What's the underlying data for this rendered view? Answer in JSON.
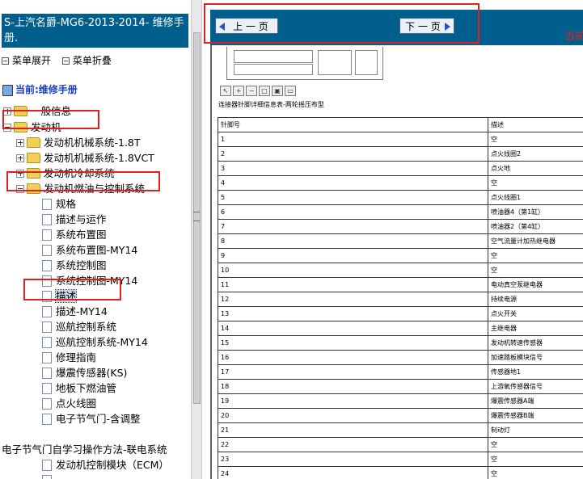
{
  "left": {
    "title": "S-上汽名爵-MG6-2013-2014- 维修手册.",
    "menu": {
      "expand_label": "菜单展开",
      "collapse_label": "菜单折叠"
    },
    "current_label": "当前:维修手册",
    "tree": [
      {
        "label": "一般信息",
        "type": "folder",
        "toggle": "plus"
      },
      {
        "label": "发动机",
        "type": "folder",
        "toggle": "minus"
      },
      {
        "label": "发动机机械系统-1.8T",
        "type": "folder",
        "toggle": "plus"
      },
      {
        "label": "发动机机械系统-1.8VCT",
        "type": "folder",
        "toggle": "plus"
      },
      {
        "label": "发动机冷却系统",
        "type": "folder",
        "toggle": "plus"
      },
      {
        "label": "发动机燃油与控制系统",
        "type": "folder",
        "toggle": "minus"
      },
      {
        "label": "规格",
        "type": "doc"
      },
      {
        "label": "描述与运作",
        "type": "doc"
      },
      {
        "label": "系统布置图",
        "type": "doc"
      },
      {
        "label": "系统布置图-MY14",
        "type": "doc"
      },
      {
        "label": "系统控制图",
        "type": "doc"
      },
      {
        "label": "系统控制图-MY14",
        "type": "doc"
      },
      {
        "label": "描述",
        "type": "doc",
        "selected": true
      },
      {
        "label": "描述-MY14",
        "type": "doc"
      },
      {
        "label": "巡航控制系统",
        "type": "doc"
      },
      {
        "label": "巡航控制系统-MY14",
        "type": "doc"
      },
      {
        "label": "修理指南",
        "type": "doc"
      },
      {
        "label": "爆震传感器(KS)",
        "type": "doc"
      },
      {
        "label": "地板下燃油管",
        "type": "doc"
      },
      {
        "label": "点火线圈",
        "type": "doc"
      },
      {
        "label": "电子节气门-含调整",
        "type": "doc"
      },
      {
        "label": "电子节气门自学习操作方法-联电系统",
        "type": "doc"
      },
      {
        "label": "发动机控制模块（ECM）",
        "type": "doc"
      },
      {
        "label": "",
        "type": "doc"
      }
    ]
  },
  "right": {
    "prev_label": "上 一 页",
    "next_label": "下 一 页",
    "current_label": "当前",
    "caption": "连接器针脚详细信息表-两轮摇压布型",
    "table": {
      "headers": [
        "针脚号",
        "描述"
      ],
      "rows": [
        [
          "1",
          "空"
        ],
        [
          "2",
          "点火线圈2"
        ],
        [
          "3",
          "点火地"
        ],
        [
          "4",
          "空"
        ],
        [
          "5",
          "点火线圈1"
        ],
        [
          "6",
          "喷油器4（第1缸）"
        ],
        [
          "7",
          "喷油器2（第4缸）"
        ],
        [
          "8",
          "空气流量计加热继电器"
        ],
        [
          "9",
          "空"
        ],
        [
          "10",
          "空"
        ],
        [
          "11",
          "电动真空泵继电器"
        ],
        [
          "12",
          "持续电源"
        ],
        [
          "13",
          "点火开关"
        ],
        [
          "14",
          "主继电器"
        ],
        [
          "15",
          "发动机转速传感器"
        ],
        [
          "16",
          "加速踏板模块信号"
        ],
        [
          "17",
          "传感器地1"
        ],
        [
          "18",
          "上游氧传感器信号"
        ],
        [
          "19",
          "爆震传感器A端"
        ],
        [
          "20",
          "爆震传感器B端"
        ],
        [
          "21",
          "制动灯"
        ],
        [
          "22",
          "空"
        ],
        [
          "23",
          "空"
        ],
        [
          "24",
          "空"
        ]
      ]
    }
  },
  "colors": {
    "accent": "#005f8c",
    "highlight": "#e02020",
    "folder": "#f2cf55"
  }
}
